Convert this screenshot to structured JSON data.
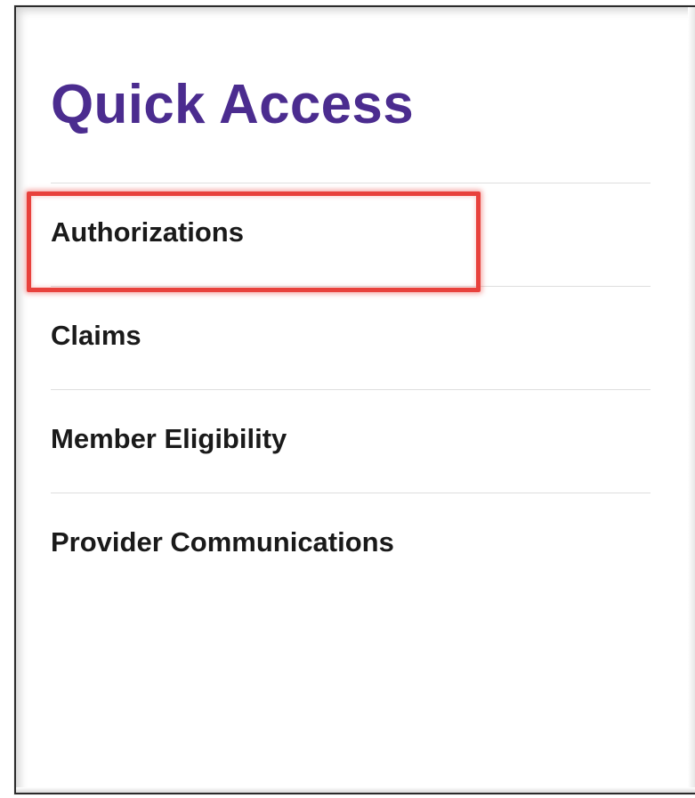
{
  "quick_access": {
    "title": "Quick Access",
    "items": [
      {
        "label": "Authorizations",
        "highlighted": true
      },
      {
        "label": "Claims",
        "highlighted": false
      },
      {
        "label": "Member Eligibility",
        "highlighted": false
      },
      {
        "label": "Provider Communications",
        "highlighted": false
      }
    ]
  },
  "colors": {
    "title": "#4b2c8f",
    "highlight": "#e8413c",
    "item_text": "#1a1a1a",
    "divider": "#dedede"
  }
}
